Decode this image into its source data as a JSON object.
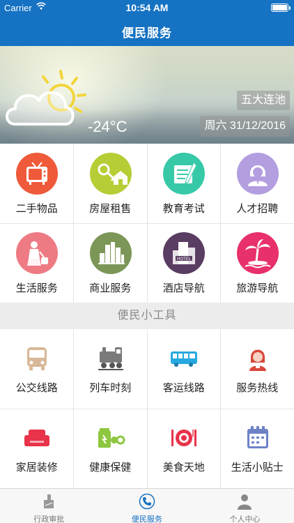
{
  "status_bar": {
    "carrier": "Carrier",
    "time": "10:54 AM"
  },
  "header": {
    "title": "便民服务"
  },
  "weather": {
    "temperature": "-24°C",
    "city": "五大连池",
    "date": "周六 31/12/2016",
    "icon": "cloud-sun-icon"
  },
  "categories": [
    {
      "label": "二手物品",
      "icon": "tv-icon",
      "color": "#ef5a3a"
    },
    {
      "label": "房屋租售",
      "icon": "house-key-icon",
      "color": "#b7cd35"
    },
    {
      "label": "教育考试",
      "icon": "document-pen-icon",
      "color": "#37c9a7"
    },
    {
      "label": "人才招聘",
      "icon": "person-icon",
      "color": "#b39ee0"
    },
    {
      "label": "生活服务",
      "icon": "cleaning-lady-icon",
      "color": "#ee7a84"
    },
    {
      "label": "商业服务",
      "icon": "city-buildings-icon",
      "color": "#7b9657"
    },
    {
      "label": "酒店导航",
      "icon": "hotel-icon",
      "color": "#5a3d62"
    },
    {
      "label": "旅游导航",
      "icon": "palm-island-icon",
      "color": "#e8306a"
    }
  ],
  "section": {
    "title": "便民小工具"
  },
  "tools": [
    {
      "label": "公交线路",
      "icon": "bus-icon",
      "color": "#d8b898"
    },
    {
      "label": "列车时刻",
      "icon": "train-icon",
      "color": "#7a7a7a"
    },
    {
      "label": "客运线路",
      "icon": "coach-icon",
      "color": "#26a9e0"
    },
    {
      "label": "服务热线",
      "icon": "service-woman-icon",
      "color": "#d9463a"
    },
    {
      "label": "家居装修",
      "icon": "sofa-icon",
      "color": "#e8334a"
    },
    {
      "label": "健康保健",
      "icon": "pill-bottle-icon",
      "color": "#8dc63f"
    },
    {
      "label": "美食天地",
      "icon": "dining-plate-icon",
      "color": "#e8334a"
    },
    {
      "label": "生活小贴士",
      "icon": "calendar-icon",
      "color": "#6f82c6"
    }
  ],
  "tabbar": [
    {
      "label": "行政审批",
      "icon": "approval-icon",
      "active": false
    },
    {
      "label": "便民服务",
      "icon": "phone-service-icon",
      "active": true
    },
    {
      "label": "个人中心",
      "icon": "user-icon",
      "active": false
    }
  ]
}
